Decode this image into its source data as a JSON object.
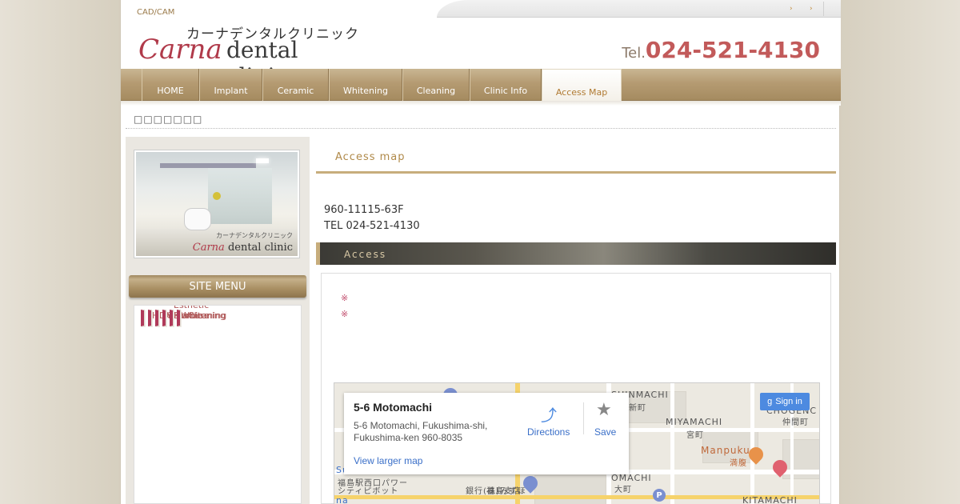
{
  "header": {
    "tagline": "CAD/CAM",
    "logo_jp": "カーナデンタルクリニック",
    "logo_carna": "Carna",
    "logo_dental": "dental clinic",
    "tel_prefix": "Tel.",
    "tel_number": "024-521-4130",
    "top_links": [
      "›",
      "›"
    ]
  },
  "nav": {
    "items": [
      "HOME",
      "Implant",
      "Ceramic",
      "Whitening",
      "Cleaning",
      "Clinic Info",
      "Access Map"
    ],
    "active_index": 6
  },
  "breadcrumb": "□□□□□□□",
  "sidebar": {
    "photo_logo_jp": "カーナデンタルクリニック",
    "photo_logo_carna": "Carna",
    "photo_logo_dental": "dental clinic",
    "menu_title": "SITE MENU",
    "menu_items": [
      "HOME",
      "Implant",
      "Ceramic",
      "Esthetic Denture",
      "Whitening",
      "Cleaning"
    ]
  },
  "main": {
    "title": "Access map",
    "address_line1": "960-11115-63F",
    "address_line2": "TEL 024-521-4130",
    "section_title": "Access",
    "notes": [
      "※",
      "※"
    ]
  },
  "map": {
    "card_title": "5-6 Motomachi",
    "card_address_line1": "5-6 Motomachi, Fukushima-shi,",
    "card_address_line2": "Fukushima-ken 960-8035",
    "card_larger_map": "View larger map",
    "directions_label": "Directions",
    "save_label": "Save",
    "sign_in_label": "Sign in",
    "sign_in_glyph": "g",
    "labels": {
      "shinmachi": "SHINMACHI",
      "shinmachi_jp": "新町",
      "miyamachi": "MIYAMACHI",
      "miyamachi_jp": "宮町",
      "nakamachi": "CHOGENC",
      "nakamachi_jp": "仲間町",
      "manpuku": "Manpuku",
      "manpuku_jp": "満腹",
      "omachi": "OMACHI",
      "omachi_jp": "大町",
      "kitamachi": "KITAMACHI",
      "bank": "銀行 福島支店",
      "bank2": "(株)みずほ",
      "station": "福島駅西口パワー",
      "station2": "シティピボット",
      "left_s": "Su",
      "left_na": "na"
    }
  },
  "colors": {
    "accent_gold": "#c7ad7c",
    "brand_red": "#b03a4a",
    "tel_red": "#c25a5a",
    "link_blue": "#3a6fc8"
  }
}
